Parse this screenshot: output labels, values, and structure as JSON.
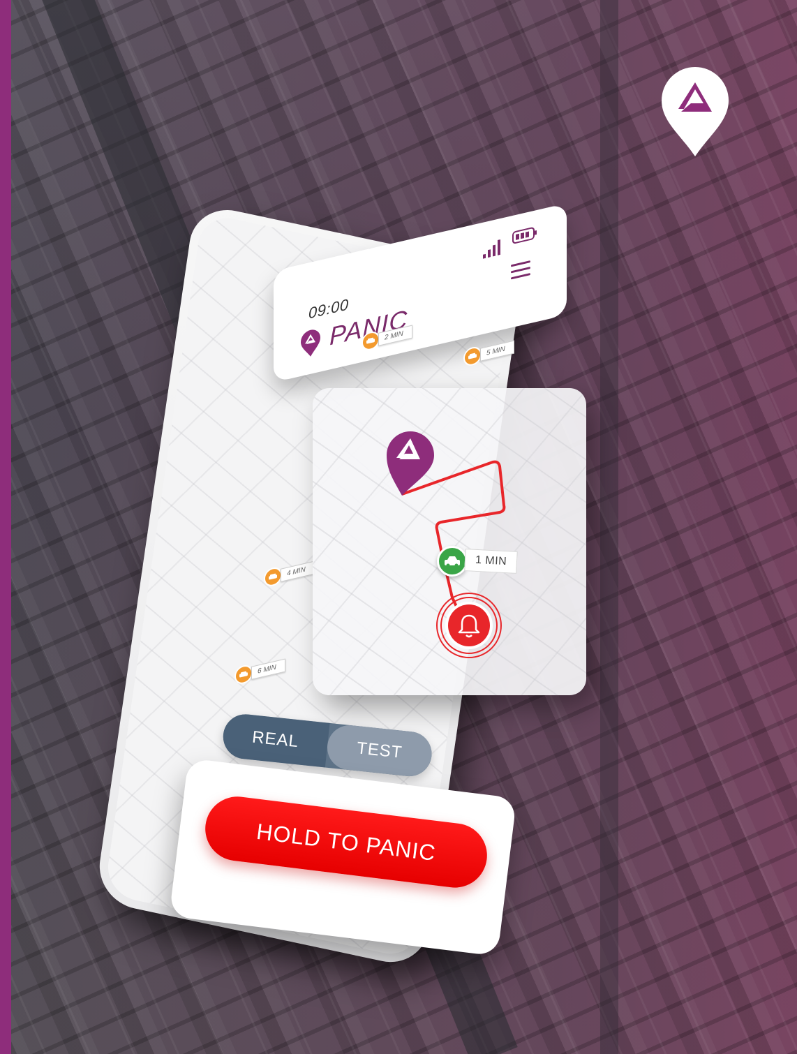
{
  "status_bar": {
    "time": "09:00",
    "signal_icon": "signal-bars-icon",
    "battery_icon": "battery-icon"
  },
  "header": {
    "title": "PANIC",
    "logo_icon": "location-pin-logo-icon",
    "menu_icon": "hamburger-menu-icon"
  },
  "map": {
    "taxis": [
      {
        "eta": "2 MIN",
        "icon": "taxi-icon"
      },
      {
        "eta": "5 MIN",
        "icon": "taxi-icon"
      },
      {
        "eta": "4 MIN",
        "icon": "taxi-icon"
      },
      {
        "eta": "6 MIN",
        "icon": "taxi-icon"
      }
    ],
    "responder": {
      "eta": "1 MIN",
      "icon": "car-icon",
      "color": "#3aa547"
    },
    "alarm_icon": "bell-alarm-icon",
    "route_color": "#e8262a",
    "pin_color": "#8e2d7b"
  },
  "mode_toggle": {
    "options": [
      "REAL",
      "TEST"
    ],
    "selected": "TEST"
  },
  "action": {
    "panic_label": "HOLD TO PANIC",
    "color": "#ff0a0a"
  },
  "brand": {
    "accent": "#8e2d7b",
    "pin_icon": "brand-location-pin-icon"
  }
}
